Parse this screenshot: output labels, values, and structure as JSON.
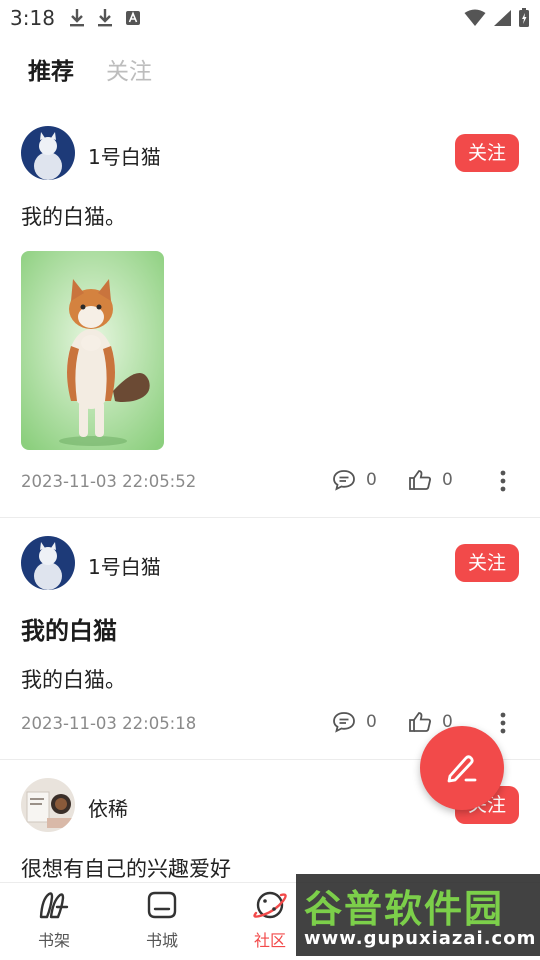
{
  "status_bar": {
    "time": "3:18",
    "left_icons": [
      "download-icon",
      "download-icon",
      "font-app-icon"
    ],
    "right_icons": [
      "wifi-icon",
      "signal-icon",
      "battery-icon"
    ]
  },
  "tabs": [
    {
      "label": "推荐",
      "active": true
    },
    {
      "label": "关注",
      "active": false
    }
  ],
  "posts": [
    {
      "author": "1号白猫",
      "follow_label": "关注",
      "title": "",
      "body": "我的白猫。",
      "has_image": true,
      "timestamp": "2023-11-03 22:05:52",
      "comments": "0",
      "likes": "0"
    },
    {
      "author": "1号白猫",
      "follow_label": "关注",
      "title": "我的白猫",
      "body": "我的白猫。",
      "has_image": false,
      "timestamp": "2023-11-03 22:05:18",
      "comments": "0",
      "likes": "0"
    },
    {
      "author": "依稀",
      "follow_label": "关注",
      "title": "",
      "body": "很想有自己的兴趣爱好"
    }
  ],
  "bottom_nav": [
    {
      "label": "书架",
      "icon": "bookshelf-icon",
      "active": false
    },
    {
      "label": "书城",
      "icon": "bookstore-icon",
      "active": false
    },
    {
      "label": "社区",
      "icon": "planet-icon",
      "active": true
    }
  ],
  "watermark": {
    "title": "谷普软件园",
    "url": "www.gupuxiazai.com"
  },
  "colors": {
    "accent": "#f24a4a",
    "text_primary": "#222222",
    "text_secondary": "#8a8a8a"
  }
}
